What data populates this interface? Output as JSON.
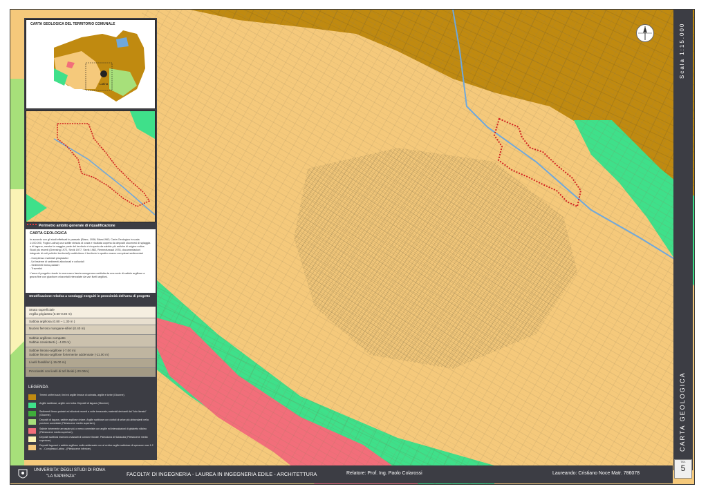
{
  "inset": {
    "title": "CARTA GEOLOGICA DEL TERRITORIO COMUNALE",
    "city_label": "Latina"
  },
  "perimeter_legend": {
    "label": "Perimetro ambito generale di riqualificazione"
  },
  "geology_text": {
    "title": "CARTA GEOLOGICA",
    "body": "In accordo con gli studi effettuati in passato (Blanc, 1936; Blanc1962; Carta Geologica in scala 1:100.000, Foglio Latina) una sottile striscia di costa e  risultata coperta da depositi olocenesi di spiaggia  e di laguna, mentre la maggior parte del territorio è ricoperto da sabbie più antiche di origine eolica. Studi più recenti (Dreesing 1972, Sevik 1977, Sevik 1982, Remmelzwaal 1978, documentazioni integrate di enti pubblici territoriali) suddividono il territorio in quattro macro complessi sedimentari",
    "list": [
      "- Complesso materiali piroplastici",
      "- Un'insieme di sedimenti alluvionali e colluviali",
      "- Sedimenti lismo-palustri",
      "- Travertini"
    ],
    "footer": "L'area di progetto ricade in una macro fascia omogenea costituita da una serie di sabbie argillose a grana fine con giaciture orizzontali intercalate da vari livelli argillosi."
  },
  "stratification": {
    "title": "Stratificazione relativa a sondaggi eseguiti in prossimità dell'area di progetto",
    "rows": [
      {
        "text": "Strato superficiale\nArgilla grigiastra (0.50-0.80 m)",
        "color": "#f5eee0"
      },
      {
        "text": "Sabbia argillosa (0.80 – 1.30 m )",
        "color": "#e8dfcf"
      },
      {
        "text": "Nucleo ferroso mangane-sifieri (0.40 m)",
        "color": "#d8ceba"
      },
      {
        "text": "Sabbie argillose compatte\nSabbie consistenti ( - 4.00 m)",
        "color": "#cbc1ad"
      },
      {
        "text": "Sabbie limoso-argillose (-7.00 m)\nSabbie limoso-argillose fortemente addensate (-11.00 m)",
        "color": "#bfb5a0"
      },
      {
        "text": "Livelli fossiliferi (-15.00 m)",
        "color": "#b0a690"
      },
      {
        "text": "Prroclastiti con livelli di tufi litoidi (-20.00m)",
        "color": "#a39a85"
      }
    ]
  },
  "legend": {
    "title": "LEGENDA",
    "items": [
      {
        "color": "#c08a10",
        "text": "Terreni uniferi scuri; limi ed argille limose di colmata, argille e torbe (Olocene)."
      },
      {
        "color": "#3fe08a",
        "text": "Argille sabbiose, argille con torba. Depositi di laguna (Olocene)."
      },
      {
        "color": "#3fae3a",
        "text": "Sedimenti limno-palustri ed alluvioni recenti a volte terrazzate; materiali derivanti dai \"tufo lionato\" (Olocene)."
      },
      {
        "color": "#a7e07a",
        "text": "Depositi di laguna, sabbie argillose chiare. Argille sabbiose con ciottoli di selce più abbondanti nella porzione sommitale (Pleistocene medio superiore)."
      },
      {
        "color": "#f26e7a",
        "text": "Sabbie fortemente arrossate più o meno commiste con argille ed intercalazioni di ghiaietto silicieo (Pleistocene medio superiore)."
      },
      {
        "color": "#faf3b5",
        "text": "Depositi sabbiosi mamone-massalti di cordone litorale. Paleoduna di Sabaudia (Pleistocene medio superiore)."
      },
      {
        "color": "#f5c97b",
        "text": "Depositi lagunari e sabbie argillose molto addensate con al vertice argille sabbiose di spessore max 1.2 m. - Complesso Latina - (Pleistocene inferiore)."
      }
    ]
  },
  "scale": {
    "label": "Scala 1:15.000"
  },
  "sheet_title": "CARTA GEOLOGICA",
  "tav": {
    "label": "TAV.",
    "number": "5"
  },
  "footer": {
    "university_1": "UNIVERSITA' DEGLI STUDI DI ROMA",
    "university_2": "\"LA SAPIENZA\"",
    "faculty": "FACOLTA' DI INGEGNERIA  -  LAUREA IN INGEGNERIA EDILE - ARCHITETTURA",
    "supervisor": "Relatore: Prof. Ing. Paolo Colarossi",
    "student": "Laureando: Cristiano Noce   Matr. 786078"
  },
  "colors": {
    "latina_complex": "#f5c97b",
    "olocene_brown": "#c08a10",
    "laguna_green": "#3fe08a",
    "red_sands": "#f26e7a",
    "canal_blue": "#6fa8dc",
    "perimeter_red": "#d02020",
    "panel_dark": "#3c3d44"
  }
}
